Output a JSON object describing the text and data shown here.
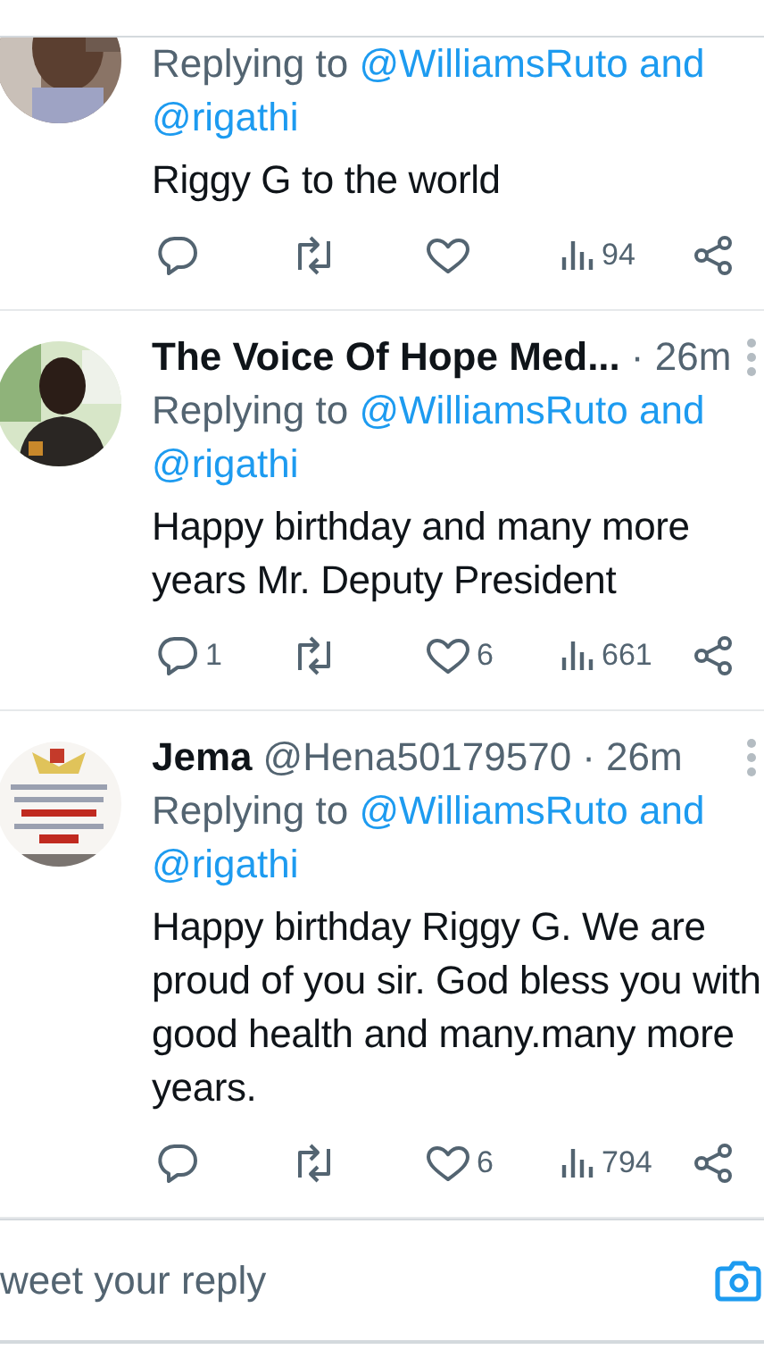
{
  "tweets": [
    {
      "avatar": {
        "kind": "picture"
      },
      "replying_prefix": "Replying to",
      "mentions": [
        "@WilliamsRuto",
        "@rigathi"
      ],
      "mention_joiner": "and",
      "text": "Riggy G to the world",
      "stats": {
        "views": "94"
      }
    },
    {
      "avatar": {
        "kind": "picture"
      },
      "author": {
        "name": "The Voice Of Hope Med...",
        "time": "· 26m"
      },
      "replying_prefix": "Replying to",
      "mentions": [
        "@WilliamsRuto",
        "@rigathi"
      ],
      "mention_joiner": "and",
      "text": "Happy birthday and many more years Mr. Deputy President",
      "stats": {
        "replies": "1",
        "likes": "6",
        "views": "661"
      }
    },
    {
      "avatar": {
        "kind": "picture"
      },
      "author": {
        "name": "Jema",
        "handle": "@Hena50179570",
        "time": "· 26m"
      },
      "replying_prefix": "Replying to",
      "mentions": [
        "@WilliamsRuto",
        "@rigathi"
      ],
      "mention_joiner": "and",
      "text": "Happy birthday Riggy G. We are proud of you sir. God bless you with good health and many.many more years.",
      "stats": {
        "likes": "6",
        "views": "794"
      }
    }
  ],
  "reply_box": {
    "placeholder": "weet your reply"
  }
}
